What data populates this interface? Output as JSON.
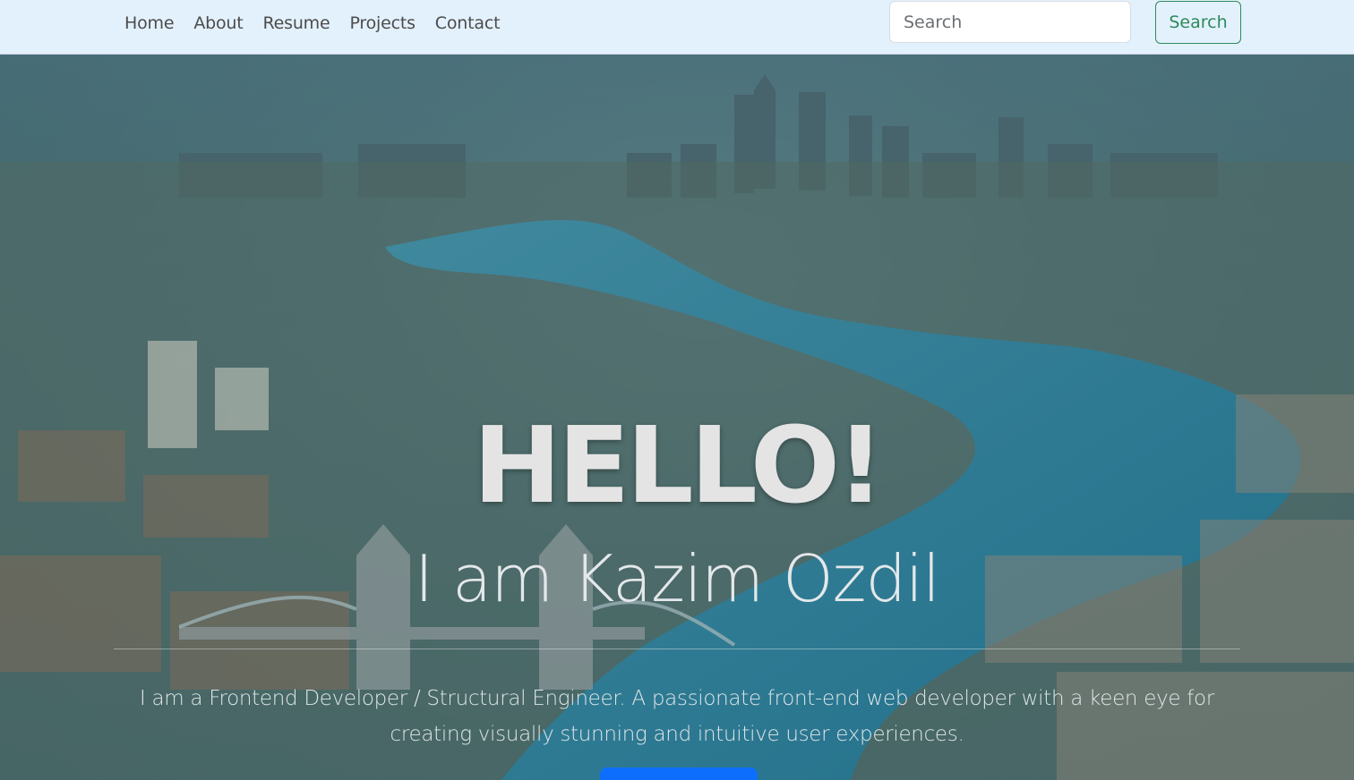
{
  "navbar": {
    "links": [
      {
        "label": "Home"
      },
      {
        "label": "About"
      },
      {
        "label": "Resume"
      },
      {
        "label": "Projects"
      },
      {
        "label": "Contact"
      }
    ],
    "search": {
      "placeholder": "Search",
      "value": "",
      "button_label": "Search"
    },
    "colors": {
      "background": "#e3f1fc",
      "link": "#4c4c4c",
      "button_accent": "#2c8a5d"
    }
  },
  "hero": {
    "title": "HELLO!",
    "subtitle": "I am Kazim Ozdil",
    "description_line1": "I am a Frontend Developer / Structural Engineer. A passionate front-end web developer with a keen eye for",
    "description_line2": "creating visually stunning and intuitive user experiences.",
    "cta_label": "",
    "colors": {
      "overlay": "#1e6478",
      "cta": "#0d6efd",
      "text": "#e4e4e4"
    }
  }
}
